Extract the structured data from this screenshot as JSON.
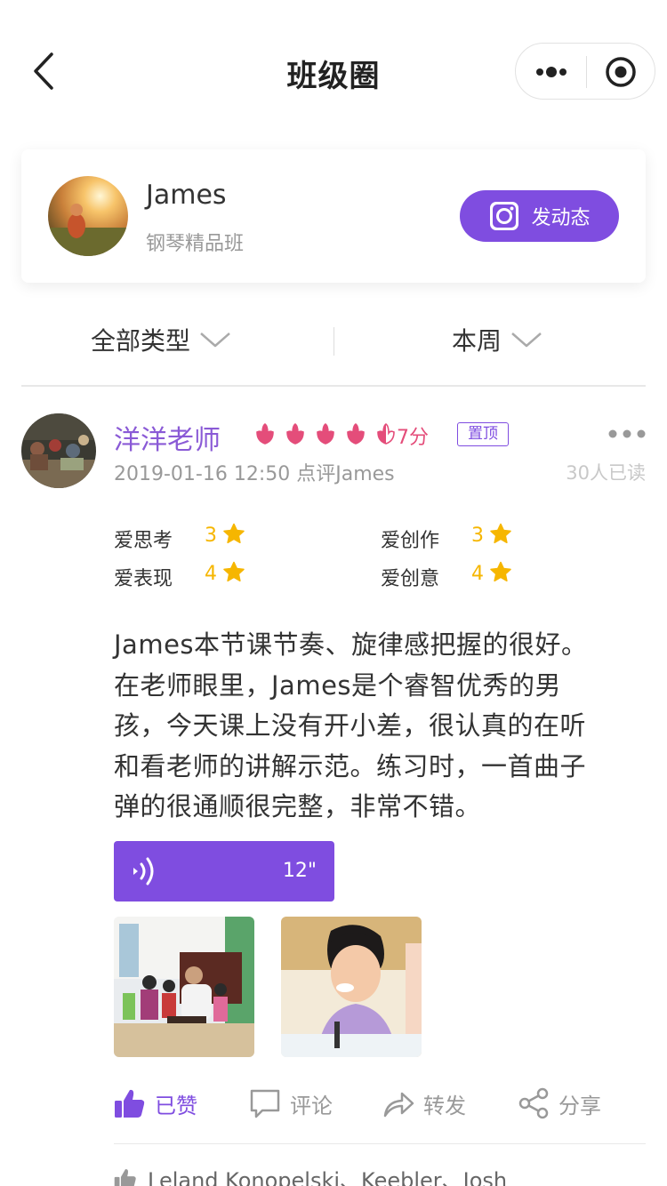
{
  "nav": {
    "title": "班级圈"
  },
  "profile": {
    "name": "James",
    "class_name": "钢琴精品班",
    "post_button": "发动态"
  },
  "filters": {
    "type": "全部类型",
    "period": "本周"
  },
  "post": {
    "teacher": "洋洋老师",
    "score_flowers": 4.5,
    "score_max": 5,
    "score": "7分",
    "pinned_label": "置顶",
    "meta": "2019-01-16 12:50 点评James",
    "read_count": "30人已读",
    "ratings": [
      {
        "label": "爱思考",
        "value": "3"
      },
      {
        "label": "爱创作",
        "value": "3"
      },
      {
        "label": "爱表现",
        "value": "4"
      },
      {
        "label": "爱创意",
        "value": "4"
      }
    ],
    "text_lines": [
      "James本节课节奏、旋律感把握的很好。",
      "在老师眼里，James是个睿智优秀的男",
      "孩，今天课上没有开小差，很认真的在听",
      "和看老师的讲解示范。练习时，一首曲子",
      "弹的很通顺很完整，非常不错。"
    ],
    "voice_duration": "12\"",
    "actions": {
      "like": "已赞",
      "comment": "评论",
      "forward": "转发",
      "share": "分享"
    },
    "likers": "Leland Konopelski、Keebler、Josh"
  },
  "colors": {
    "accent": "#7f4de0",
    "teacher_name": "#8a5ad6",
    "score": "#e44d7a",
    "star": "#f6b600"
  }
}
